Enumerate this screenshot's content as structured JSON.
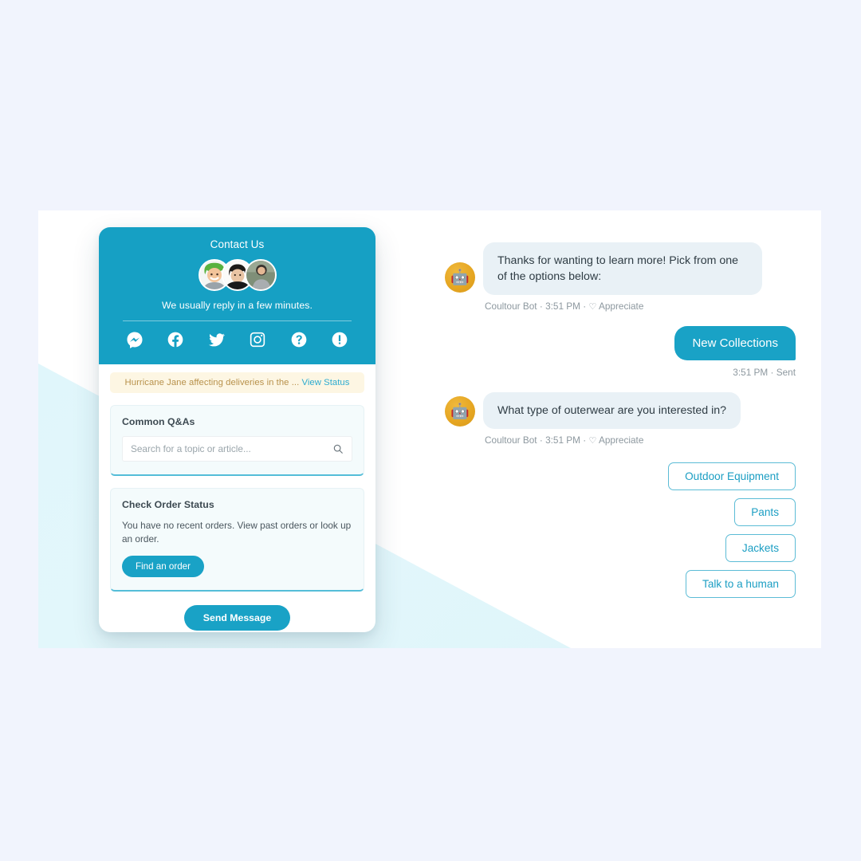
{
  "page": {
    "background_color": "#f1f4fd",
    "canvas_color": "#ffffff",
    "accent_color": "#19a2c6",
    "wedge_color": "#dff6fb"
  },
  "widget": {
    "header": {
      "title": "Contact Us",
      "reply_time": "We usually reply in a few minutes.",
      "avatars": [
        {
          "name": "agent-avatar-1"
        },
        {
          "name": "agent-avatar-2"
        },
        {
          "name": "agent-avatar-3"
        }
      ],
      "socials": [
        {
          "icon": "messenger-icon",
          "label": "Messenger"
        },
        {
          "icon": "facebook-icon",
          "label": "Facebook"
        },
        {
          "icon": "twitter-icon",
          "label": "Twitter"
        },
        {
          "icon": "instagram-icon",
          "label": "Instagram"
        },
        {
          "icon": "question-circle-icon",
          "label": "Help"
        },
        {
          "icon": "exclamation-circle-icon",
          "label": "Alert"
        }
      ]
    },
    "banner": {
      "text": "Hurricane Jane affecting deliveries in the ...",
      "link_label": "View Status",
      "background_color": "#fdf6e3",
      "text_color": "#b8914b",
      "link_color": "#2cabd0"
    },
    "qa_panel": {
      "title": "Common Q&As",
      "search_placeholder": "Search for a topic or article...",
      "search_value": "",
      "search_icon": "search-icon"
    },
    "order_panel": {
      "title": "Check Order Status",
      "body": "You have no recent orders. View past orders or look up an order.",
      "button_label": "Find an order"
    },
    "send_message_label": "Send Message"
  },
  "chat": {
    "messages": [
      {
        "type": "incoming",
        "text": "Thanks for wanting to learn more! Pick from one of the options below:",
        "sender": "Coultour Bot",
        "time": "3:51 PM",
        "reaction_label": "Appreciate",
        "avatar_icon": "robot-icon"
      },
      {
        "type": "outgoing",
        "text": "New Collections",
        "time": "3:51 PM",
        "status": "Sent"
      },
      {
        "type": "incoming",
        "text": "What type of outerwear are you interested in?",
        "sender": "Coultour Bot",
        "time": "3:51 PM",
        "reaction_label": "Appreciate",
        "avatar_icon": "robot-icon"
      }
    ],
    "meta_separator": " · ",
    "heart_glyph": "♡",
    "robot_glyph": "🤖",
    "quick_replies": [
      {
        "label": "Outdoor Equipment"
      },
      {
        "label": "Pants"
      },
      {
        "label": "Jackets"
      },
      {
        "label": "Talk to a human"
      }
    ]
  }
}
